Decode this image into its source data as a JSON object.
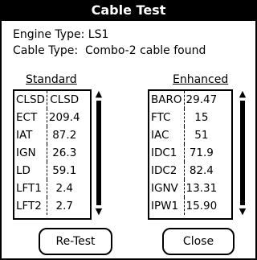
{
  "window": {
    "title": "Cable Test"
  },
  "info": {
    "engine_label": "Engine Type:",
    "engine_value": "LS1",
    "cable_label": "Cable Type:",
    "cable_value": "Combo-2 cable found"
  },
  "standard": {
    "title": "Standard",
    "rows": [
      [
        "CLSD",
        "CLSD"
      ],
      [
        "ECT",
        "209.4"
      ],
      [
        "IAT",
        "87.2"
      ],
      [
        "IGN",
        "26.3"
      ],
      [
        "LD",
        "59.1"
      ],
      [
        "LFT1",
        "2.4"
      ],
      [
        "LFT2",
        "2.7"
      ]
    ]
  },
  "enhanced": {
    "title": "Enhanced",
    "rows": [
      [
        "BARO",
        "29.47"
      ],
      [
        "FTC",
        "15"
      ],
      [
        "IAC",
        "51"
      ],
      [
        "IDC1",
        "71.9"
      ],
      [
        "IDC2",
        "82.4"
      ],
      [
        "IGNV",
        "13.31"
      ],
      [
        "IPW1",
        "15.90"
      ]
    ]
  },
  "buttons": {
    "retest": "Re-Test",
    "close": "Close"
  },
  "icons": {
    "up": "scroll-up-arrow-icon",
    "down": "scroll-down-arrow-icon"
  }
}
